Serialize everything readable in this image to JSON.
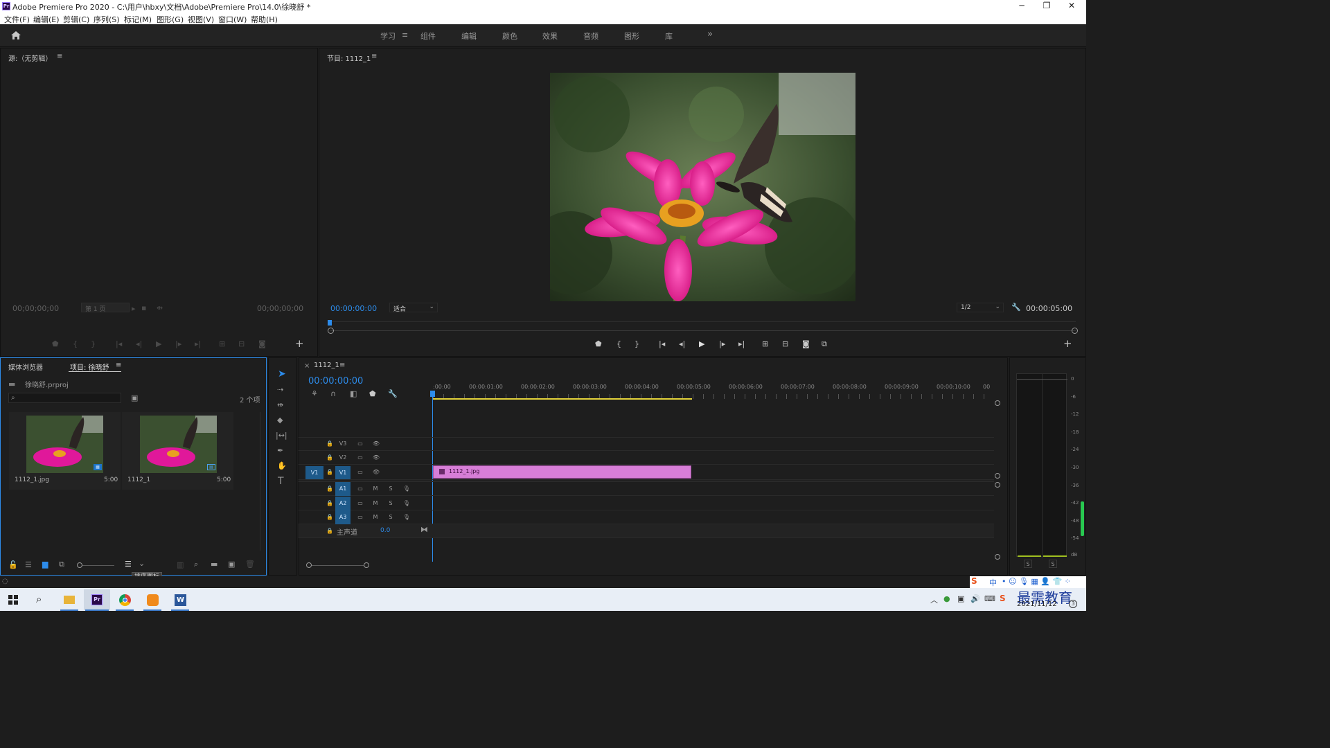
{
  "window": {
    "title": "Adobe Premiere Pro 2020 - C:\\用户\\hbxy\\文档\\Adobe\\Premiere Pro\\14.0\\徐晓舒 *",
    "logo_text": "Pr",
    "minimize": "─",
    "restore": "❐",
    "close": "✕"
  },
  "menu": [
    "文件(F)",
    "编辑(E)",
    "剪辑(C)",
    "序列(S)",
    "标记(M)",
    "图形(G)",
    "视图(V)",
    "窗口(W)",
    "帮助(H)"
  ],
  "workspaces": {
    "items": [
      "学习",
      "组件",
      "编辑",
      "颜色",
      "效果",
      "音频",
      "图形",
      "库"
    ],
    "active": "学习",
    "more": "»",
    "menu_icon": "≡"
  },
  "source_monitor": {
    "title": "源:（无剪辑）",
    "menu_icon": "≡",
    "timecode_in": "00;00;00;00",
    "page_select": "第 1 页",
    "timecode_out": "00;00;00;00"
  },
  "program_monitor": {
    "title": "节目: 1112_1",
    "menu_icon": "≡",
    "timecode": "00:00:00:00",
    "fit": "适合",
    "resolution": "1/2",
    "duration": "00:00:05:00"
  },
  "project_panel": {
    "tab_media": "媒体浏览器",
    "tab_project": "项目: 徐晓舒",
    "menu_icon": "≡",
    "project_file": "徐晓舒.prproj",
    "search_placeholder": "",
    "item_count": "2 个项",
    "items": [
      {
        "name": "1112_1.jpg",
        "duration": "5:00"
      },
      {
        "name": "1112_1",
        "duration": "5:00"
      }
    ],
    "tooltip": "排序图标"
  },
  "timeline": {
    "close": "×",
    "sequence": "1112_1",
    "menu_icon": "≡",
    "timecode": "00:00:00:00",
    "ruler": [
      ":00:00",
      "00:00:01:00",
      "00:00:02:00",
      "00:00:03:00",
      "00:00:04:00",
      "00:00:05:00",
      "00:00:06:00",
      "00:00:07:00",
      "00:00:08:00",
      "00:00:09:00",
      "00:00:10:00",
      "00"
    ],
    "video_tracks": [
      "V3",
      "V2",
      "V1"
    ],
    "source_patch": "V1",
    "audio_tracks": [
      "A1",
      "A2",
      "A3"
    ],
    "mute": "M",
    "solo": "S",
    "master_label": "主声道",
    "master_value": "0.0",
    "clip_name": "1112_1.jpg",
    "clip_color": "#d77ed7"
  },
  "audio_meter": {
    "scale": [
      "0",
      "-6",
      "-12",
      "-18",
      "-24",
      "-30",
      "-36",
      "-42",
      "-48",
      "-54",
      "dB"
    ],
    "solo_left": "S",
    "solo_right": "S"
  },
  "taskbar": {
    "date": "2021/11/12",
    "watermark": "最需教育",
    "ime": "中"
  },
  "colors": {
    "accent": "#2d8ceb",
    "clip": "#d77ed7",
    "in_out_bar": "#e3d23a"
  }
}
